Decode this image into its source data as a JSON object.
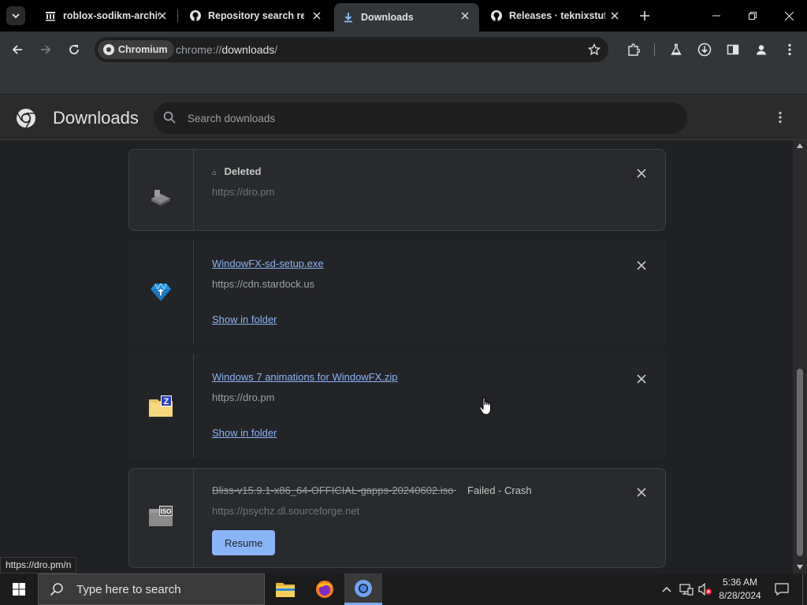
{
  "browser": {
    "tabs": [
      {
        "title": "roblox-sodikm-archive",
        "icon": "archive-icon"
      },
      {
        "title": "Repository search results",
        "icon": "github-icon"
      },
      {
        "title": "Downloads",
        "icon": "download-icon",
        "active": true
      },
      {
        "title": "Releases · teknixstuff/",
        "icon": "github-icon"
      }
    ],
    "chip_label": "Chromium",
    "url_scheme": "chrome://",
    "url_host": "downloads",
    "url_path": "/"
  },
  "downloads": {
    "title": "Downloads",
    "search_placeholder": "Search downloads",
    "items": [
      {
        "name": "",
        "status": "Deleted",
        "origin": "https://dro.pm",
        "icon": "installer-icon"
      },
      {
        "name": "WindowFX-sd-setup.exe",
        "origin": "https://cdn.stardock.us",
        "action": "Show in folder",
        "icon": "windowfx-icon"
      },
      {
        "name": "Windows 7 animations for WindowFX.zip",
        "origin": "https://dro.pm",
        "action": "Show in folder",
        "icon": "zip-folder-icon"
      },
      {
        "name": "Bliss-v15.9.1-x86_64-OFFICIAL-gapps-20240602.iso",
        "status": "Failed - Crash",
        "origin": "https://psychz.dl.sourceforge.net",
        "action": "Resume",
        "icon": "iso-icon"
      }
    ]
  },
  "status_bar_url": "https://dro.pm/n",
  "taskbar": {
    "search_placeholder": "Type here to search",
    "time": "5:36 AM",
    "date": "8/28/2024"
  },
  "colors": {
    "link": "#8ab4f8",
    "background": "#202124",
    "accent": "#8ab4f8"
  }
}
